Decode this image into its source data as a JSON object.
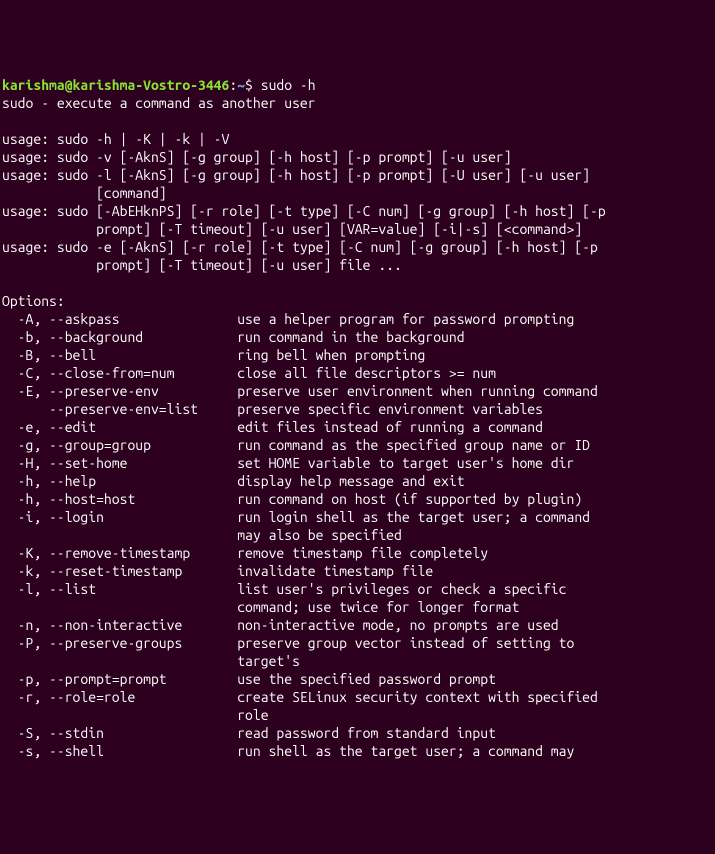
{
  "prompt": {
    "user": "karishma@karishma-Vostro-3446",
    "colon": ":",
    "path": "~",
    "dollar": "$ ",
    "command": "sudo -h"
  },
  "summary": "sudo - execute a command as another user",
  "blank1": "",
  "usage1": "usage: sudo -h | -K | -k | -V",
  "usage2": "usage: sudo -v [-AknS] [-g group] [-h host] [-p prompt] [-u user]",
  "usage3": "usage: sudo -l [-AknS] [-g group] [-h host] [-p prompt] [-U user] [-u user]",
  "usage3b": "            [command]",
  "usage4": "usage: sudo [-AbEHknPS] [-r role] [-t type] [-C num] [-g group] [-h host] [-p",
  "usage4b": "            prompt] [-T timeout] [-u user] [VAR=value] [-i|-s] [<command>]",
  "usage5": "usage: sudo -e [-AknS] [-r role] [-t type] [-C num] [-g group] [-h host] [-p",
  "usage5b": "            prompt] [-T timeout] [-u user] file ...",
  "blank2": "",
  "optionsHeader": "Options:",
  "options": [
    {
      "flag": "  -A, --askpass               ",
      "desc": "use a helper program for password prompting"
    },
    {
      "flag": "  -b, --background            ",
      "desc": "run command in the background"
    },
    {
      "flag": "  -B, --bell                  ",
      "desc": "ring bell when prompting"
    },
    {
      "flag": "  -C, --close-from=num        ",
      "desc": "close all file descriptors >= num"
    },
    {
      "flag": "  -E, --preserve-env          ",
      "desc": "preserve user environment when running command"
    },
    {
      "flag": "      --preserve-env=list     ",
      "desc": "preserve specific environment variables"
    },
    {
      "flag": "  -e, --edit                  ",
      "desc": "edit files instead of running a command"
    },
    {
      "flag": "  -g, --group=group           ",
      "desc": "run command as the specified group name or ID"
    },
    {
      "flag": "  -H, --set-home              ",
      "desc": "set HOME variable to target user's home dir"
    },
    {
      "flag": "  -h, --help                  ",
      "desc": "display help message and exit"
    },
    {
      "flag": "  -h, --host=host             ",
      "desc": "run command on host (if supported by plugin)"
    },
    {
      "flag": "  -i, --login                 ",
      "desc": "run login shell as the target user; a command"
    },
    {
      "flag": "                              ",
      "desc": "may also be specified"
    },
    {
      "flag": "  -K, --remove-timestamp      ",
      "desc": "remove timestamp file completely"
    },
    {
      "flag": "  -k, --reset-timestamp       ",
      "desc": "invalidate timestamp file"
    },
    {
      "flag": "  -l, --list                  ",
      "desc": "list user's privileges or check a specific"
    },
    {
      "flag": "                              ",
      "desc": "command; use twice for longer format"
    },
    {
      "flag": "  -n, --non-interactive       ",
      "desc": "non-interactive mode, no prompts are used"
    },
    {
      "flag": "  -P, --preserve-groups       ",
      "desc": "preserve group vector instead of setting to"
    },
    {
      "flag": "                              ",
      "desc": "target's"
    },
    {
      "flag": "  -p, --prompt=prompt         ",
      "desc": "use the specified password prompt"
    },
    {
      "flag": "  -r, --role=role             ",
      "desc": "create SELinux security context with specified"
    },
    {
      "flag": "                              ",
      "desc": "role"
    },
    {
      "flag": "  -S, --stdin                 ",
      "desc": "read password from standard input"
    },
    {
      "flag": "  -s, --shell                 ",
      "desc": "run shell as the target user; a command may"
    }
  ]
}
